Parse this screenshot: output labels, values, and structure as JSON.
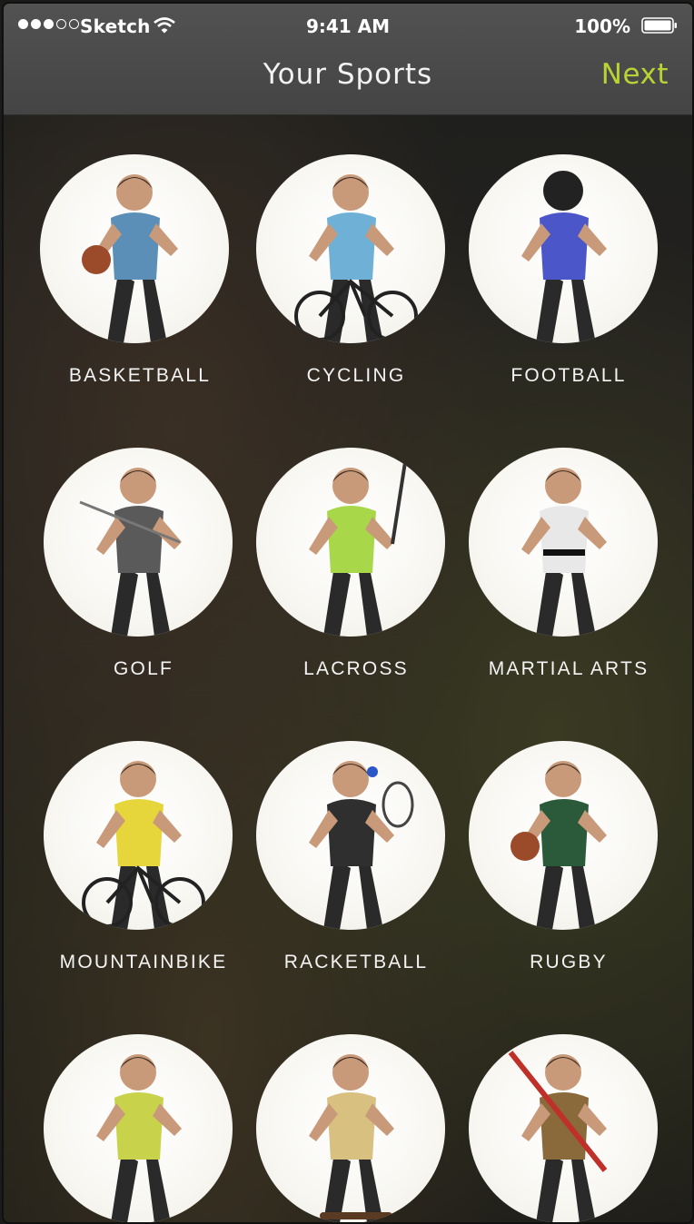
{
  "status_bar": {
    "carrier": "Sketch",
    "time": "9:41 AM",
    "battery_percent": "100%",
    "signal_filled": 3,
    "signal_total": 5
  },
  "nav": {
    "title": "Your Sports",
    "next_label": "Next",
    "accent_color": "#b9d335"
  },
  "sports": [
    {
      "label": "BASKETBALL",
      "accent": "#5b8fb8",
      "prop": "ball"
    },
    {
      "label": "CYCLING",
      "accent": "#6fb0d6",
      "prop": "bike"
    },
    {
      "label": "FOOTBALL",
      "accent": "#4b56c8",
      "prop": "helmet"
    },
    {
      "label": "GOLF",
      "accent": "#5a5a5a",
      "prop": "club"
    },
    {
      "label": "LACROSS",
      "accent": "#a8d84a",
      "prop": "stick"
    },
    {
      "label": "MARTIAL ARTS",
      "accent": "#e8e8e8",
      "prop": "belt"
    },
    {
      "label": "MOUNTAINBIKE",
      "accent": "#e6d63c",
      "prop": "bike"
    },
    {
      "label": "RACKETBALL",
      "accent": "#2f2f2f",
      "prop": "racket"
    },
    {
      "label": "RUGBY",
      "accent": "#2b5a3a",
      "prop": "ball"
    },
    {
      "label": "",
      "accent": "#c8d24a",
      "prop": "run"
    },
    {
      "label": "",
      "accent": "#d8c080",
      "prop": "skate"
    },
    {
      "label": "",
      "accent": "#8a6a3a",
      "prop": "ski"
    }
  ]
}
